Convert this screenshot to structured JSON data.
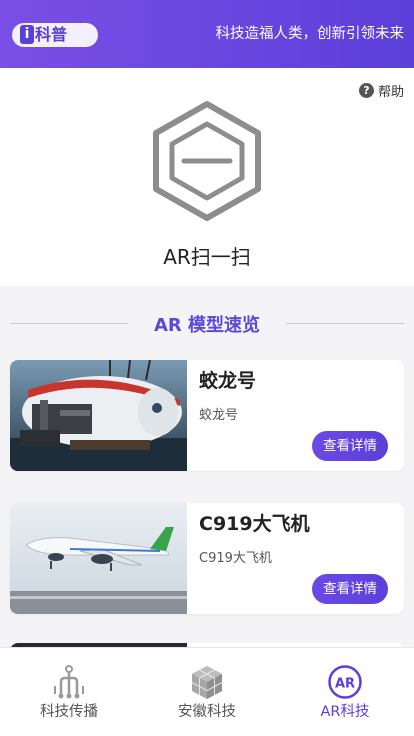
{
  "header": {
    "logo_letter": "i",
    "logo_text": "科普",
    "slogan": "科技造福人类，创新引领未来"
  },
  "scan": {
    "help_label": "帮助",
    "help_icon": "?",
    "title": "AR扫一扫"
  },
  "section": {
    "title": "AR 模型速览"
  },
  "cards": [
    {
      "title": "蛟龙号",
      "subtitle": "蛟龙号",
      "button": "查看详情"
    },
    {
      "title": "C919大飞机",
      "subtitle": "C919大飞机",
      "button": "查看详情"
    }
  ],
  "tabs": [
    {
      "label": "科技传播",
      "icon": "network-icon",
      "active": false
    },
    {
      "label": "安徽科技",
      "icon": "cube-icon",
      "active": false
    },
    {
      "label": "AR科技",
      "icon": "ar-icon",
      "icon_text": "AR",
      "active": true
    }
  ],
  "colors": {
    "accent": "#5b3fd9",
    "header_start": "#7a4fe6",
    "header_end": "#5b3fd9"
  }
}
